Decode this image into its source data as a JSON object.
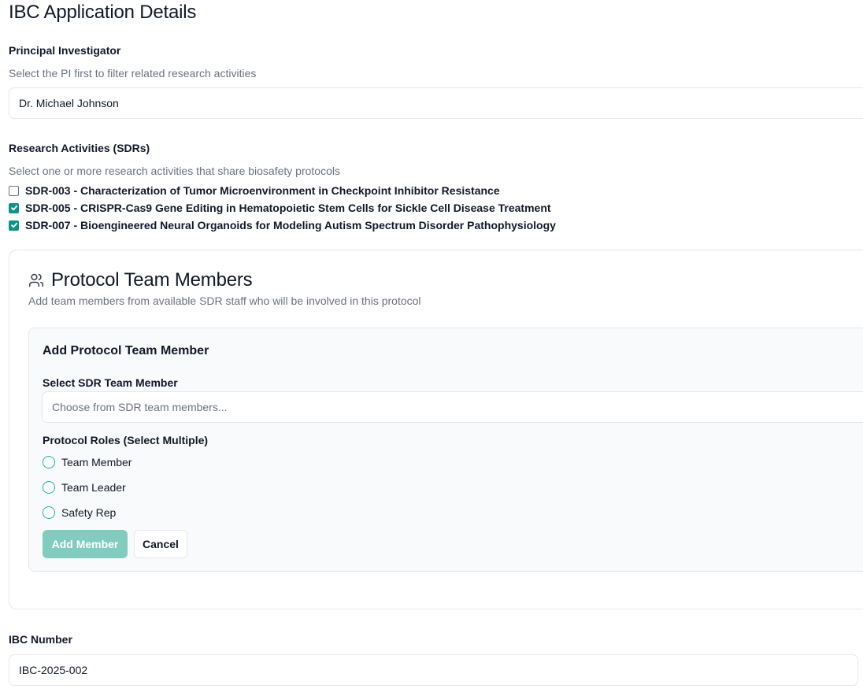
{
  "page": {
    "title": "IBC Application Details"
  },
  "pi": {
    "label": "Principal Investigator",
    "help": "Select the PI first to filter related research activities",
    "value": "Dr. Michael Johnson"
  },
  "sdrs": {
    "label": "Research Activities (SDRs)",
    "help": "Select one or more research activities that share biosafety protocols",
    "items": [
      {
        "label": "SDR-003 - Characterization of Tumor Microenvironment in Checkpoint Inhibitor Resistance",
        "checked": false
      },
      {
        "label": "SDR-005 - CRISPR-Cas9 Gene Editing in Hematopoietic Stem Cells for Sickle Cell Disease Treatment",
        "checked": true
      },
      {
        "label": "SDR-007 - Bioengineered Neural Organoids for Modeling Autism Spectrum Disorder Pathophysiology",
        "checked": true
      }
    ]
  },
  "team": {
    "icon": "users-icon",
    "title": "Protocol Team Members",
    "subtitle": "Add team members from available SDR staff who will be involved in this protocol",
    "add_panel": {
      "title": "Add Protocol Team Member",
      "select_label": "Select SDR Team Member",
      "select_placeholder": "Choose from SDR team members...",
      "roles_label": "Protocol Roles (Select Multiple)",
      "roles": [
        "Team Member",
        "Team Leader",
        "Safety Rep"
      ],
      "add_button": "Add Member",
      "cancel_button": "Cancel"
    }
  },
  "ibc": {
    "label": "IBC Number",
    "value": "IBC-2025-002"
  },
  "colors": {
    "accent": "#0d9488",
    "radio_border": "#14b8a6",
    "add_button_disabled": "#81cbbf",
    "muted_text": "#6b7280",
    "border": "#e5e7eb"
  }
}
